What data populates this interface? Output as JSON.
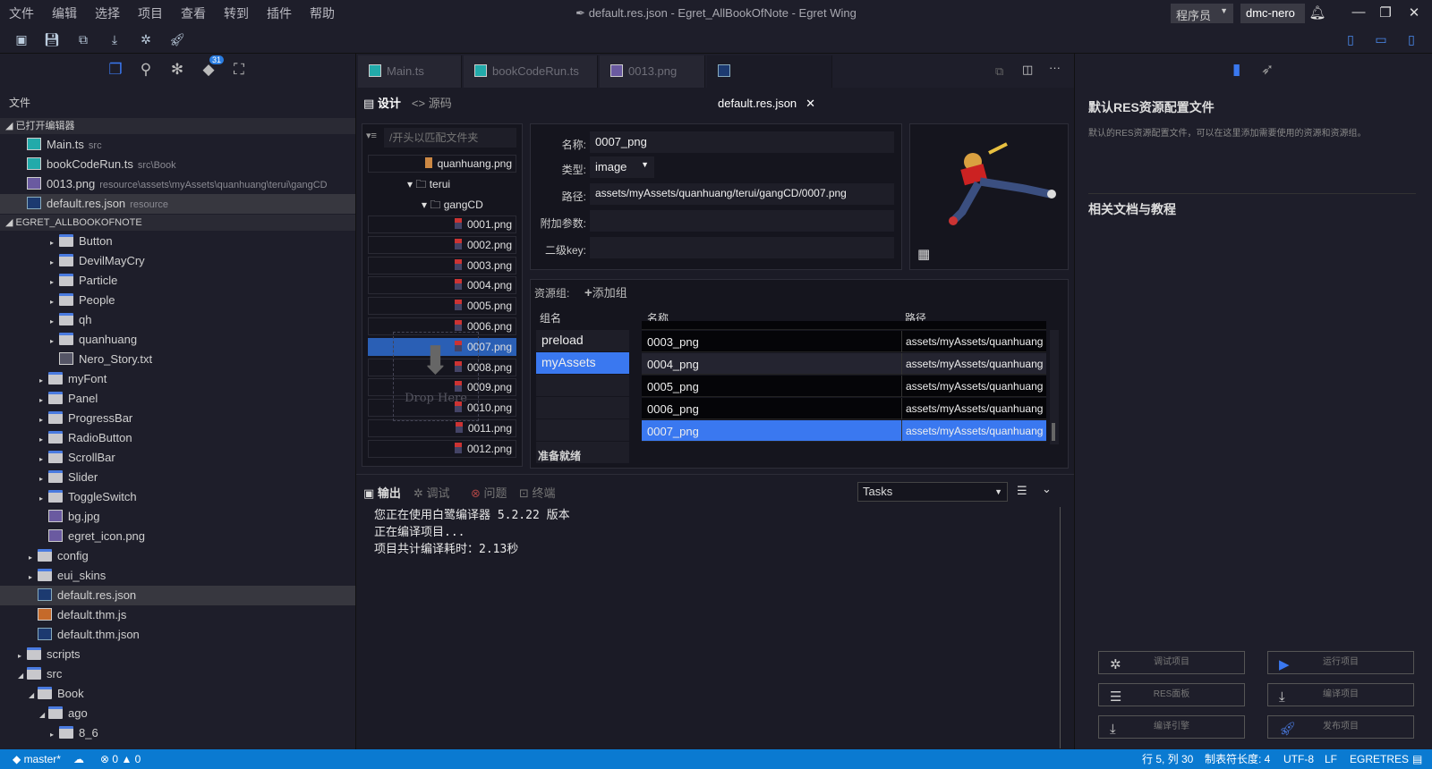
{
  "menu": [
    "文件",
    "编辑",
    "选择",
    "项目",
    "查看",
    "转到",
    "插件",
    "帮助"
  ],
  "window": {
    "title": "default.res.json - Egret_AllBookOfNote - Egret Wing",
    "role": "程序员",
    "user": "dmc-nero"
  },
  "toolbar_icons": [
    "new-folder-icon",
    "save-icon",
    "save-all-icon",
    "build-icon",
    "debug-icon",
    "publish-icon"
  ],
  "activity": {
    "badge": "31"
  },
  "sidebar": {
    "title": "文件",
    "open_editors_header": "已打开编辑器",
    "open_editors": [
      {
        "name": "Main.ts",
        "hint": "src",
        "type": "ts"
      },
      {
        "name": "bookCodeRun.ts",
        "hint": "src\\Book",
        "type": "ts"
      },
      {
        "name": "0013.png",
        "hint": "resource\\assets\\myAssets\\quanhuang\\terui\\gangCD",
        "type": "png"
      },
      {
        "name": "default.res.json",
        "hint": "resource",
        "type": "json"
      }
    ],
    "project_header": "EGRET_ALLBOOKOFNOTE",
    "tree": [
      {
        "name": "Button",
        "type": "folder",
        "depth": 4,
        "tw": "▸"
      },
      {
        "name": "DevilMayCry",
        "type": "folder",
        "depth": 4,
        "tw": "▸"
      },
      {
        "name": "Particle",
        "type": "folder",
        "depth": 4,
        "tw": "▸"
      },
      {
        "name": "People",
        "type": "folder",
        "depth": 4,
        "tw": "▸"
      },
      {
        "name": "qh",
        "type": "folder",
        "depth": 4,
        "tw": "▸"
      },
      {
        "name": "quanhuang",
        "type": "folder",
        "depth": 4,
        "tw": "▸"
      },
      {
        "name": "Nero_Story.txt",
        "type": "txt",
        "depth": 4,
        "tw": ""
      },
      {
        "name": "myFont",
        "type": "folder",
        "depth": 3,
        "tw": "▸"
      },
      {
        "name": "Panel",
        "type": "folder",
        "depth": 3,
        "tw": "▸"
      },
      {
        "name": "ProgressBar",
        "type": "folder",
        "depth": 3,
        "tw": "▸"
      },
      {
        "name": "RadioButton",
        "type": "folder",
        "depth": 3,
        "tw": "▸"
      },
      {
        "name": "ScrollBar",
        "type": "folder",
        "depth": 3,
        "tw": "▸"
      },
      {
        "name": "Slider",
        "type": "folder",
        "depth": 3,
        "tw": "▸"
      },
      {
        "name": "ToggleSwitch",
        "type": "folder",
        "depth": 3,
        "tw": "▸"
      },
      {
        "name": "bg.jpg",
        "type": "png",
        "depth": 3,
        "tw": ""
      },
      {
        "name": "egret_icon.png",
        "type": "png",
        "depth": 3,
        "tw": ""
      },
      {
        "name": "config",
        "type": "folder",
        "depth": 2,
        "tw": "▸"
      },
      {
        "name": "eui_skins",
        "type": "folder",
        "depth": 2,
        "tw": "▸"
      },
      {
        "name": "default.res.json",
        "type": "json",
        "depth": 2,
        "tw": "",
        "selected": true
      },
      {
        "name": "default.thm.js",
        "type": "js",
        "depth": 2,
        "tw": ""
      },
      {
        "name": "default.thm.json",
        "type": "json",
        "depth": 2,
        "tw": ""
      },
      {
        "name": "scripts",
        "type": "folder",
        "depth": 1,
        "tw": "▸"
      },
      {
        "name": "src",
        "type": "folder",
        "depth": 1,
        "tw": "◢"
      },
      {
        "name": "Book",
        "type": "folder",
        "depth": 2,
        "tw": "◢"
      },
      {
        "name": "ago",
        "type": "folder",
        "depth": 3,
        "tw": "◢"
      },
      {
        "name": "8_6",
        "type": "folder",
        "depth": 4,
        "tw": "▸"
      }
    ]
  },
  "tabs": [
    {
      "name": "Main.ts",
      "type": "ts"
    },
    {
      "name": "bookCodeRun.ts",
      "type": "ts"
    },
    {
      "name": "0013.png",
      "type": "png"
    },
    {
      "name": "default.res.json",
      "type": "json",
      "active": true
    }
  ],
  "view": {
    "design": "设计",
    "source": "源码"
  },
  "restree": {
    "filter_placeholder": "/开头以匹配文件夹",
    "sheet": "quanhuang.png",
    "folder1": "terui",
    "folder2": "gangCD",
    "files": [
      "0001.png",
      "0002.png",
      "0003.png",
      "0004.png",
      "0005.png",
      "0006.png",
      "0007.png",
      "0008.png",
      "0009.png",
      "0010.png",
      "0011.png",
      "0012.png"
    ],
    "selected": "0007.png",
    "drop": "Drop Here"
  },
  "props": {
    "name_label": "名称:",
    "name": "0007_png",
    "type_label": "类型:",
    "type": "image",
    "path_label": "路径:",
    "path": "assets/myAssets/quanhuang/terui/gangCD/0007.png",
    "params_label": "附加参数:",
    "params": "",
    "subkey_label": "二级key:",
    "subkey": ""
  },
  "groups": {
    "label": "资源组:",
    "add": "添加组",
    "col_group": "组名",
    "col_name": "名称",
    "col_path": "路径",
    "items": [
      "preload",
      "myAssets"
    ],
    "selected": "myAssets",
    "status": "准备就绪",
    "resources": [
      {
        "name": "0003_png",
        "path": "assets/myAssets/quanhuang"
      },
      {
        "name": "0004_png",
        "path": "assets/myAssets/quanhuang"
      },
      {
        "name": "0005_png",
        "path": "assets/myAssets/quanhuang"
      },
      {
        "name": "0006_png",
        "path": "assets/myAssets/quanhuang"
      },
      {
        "name": "0007_png",
        "path": "assets/myAssets/quanhuang",
        "selected": true
      }
    ]
  },
  "output": {
    "tabs": [
      "输出",
      "调试",
      "问题",
      "终端"
    ],
    "task": "Tasks",
    "lines": [
      "您正在使用白鹭编译器 5.2.22 版本",
      "正在编译项目...",
      "项目共计编译耗时：2.13秒"
    ]
  },
  "right": {
    "title": "默认RES资源配置文件",
    "desc": "默认的RES资源配置文件，可以在这里添加需要使用的资源和资源组。",
    "docs": "相关文档与教程",
    "buttons": [
      "调试项目",
      "运行项目",
      "RES面板",
      "编译项目",
      "编译引擎",
      "发布项目"
    ]
  },
  "status": {
    "branch": "master*",
    "errors": "0",
    "warnings": "0",
    "position": "行 5, 列 30",
    "tab": "制表符长度: 4",
    "encoding": "UTF-8",
    "eol": "LF",
    "lang": "EGRETRES"
  },
  "colors": {
    "accent": "#3a78f0",
    "status_bar": "#0a7ad1",
    "background": "#1b1b26"
  }
}
